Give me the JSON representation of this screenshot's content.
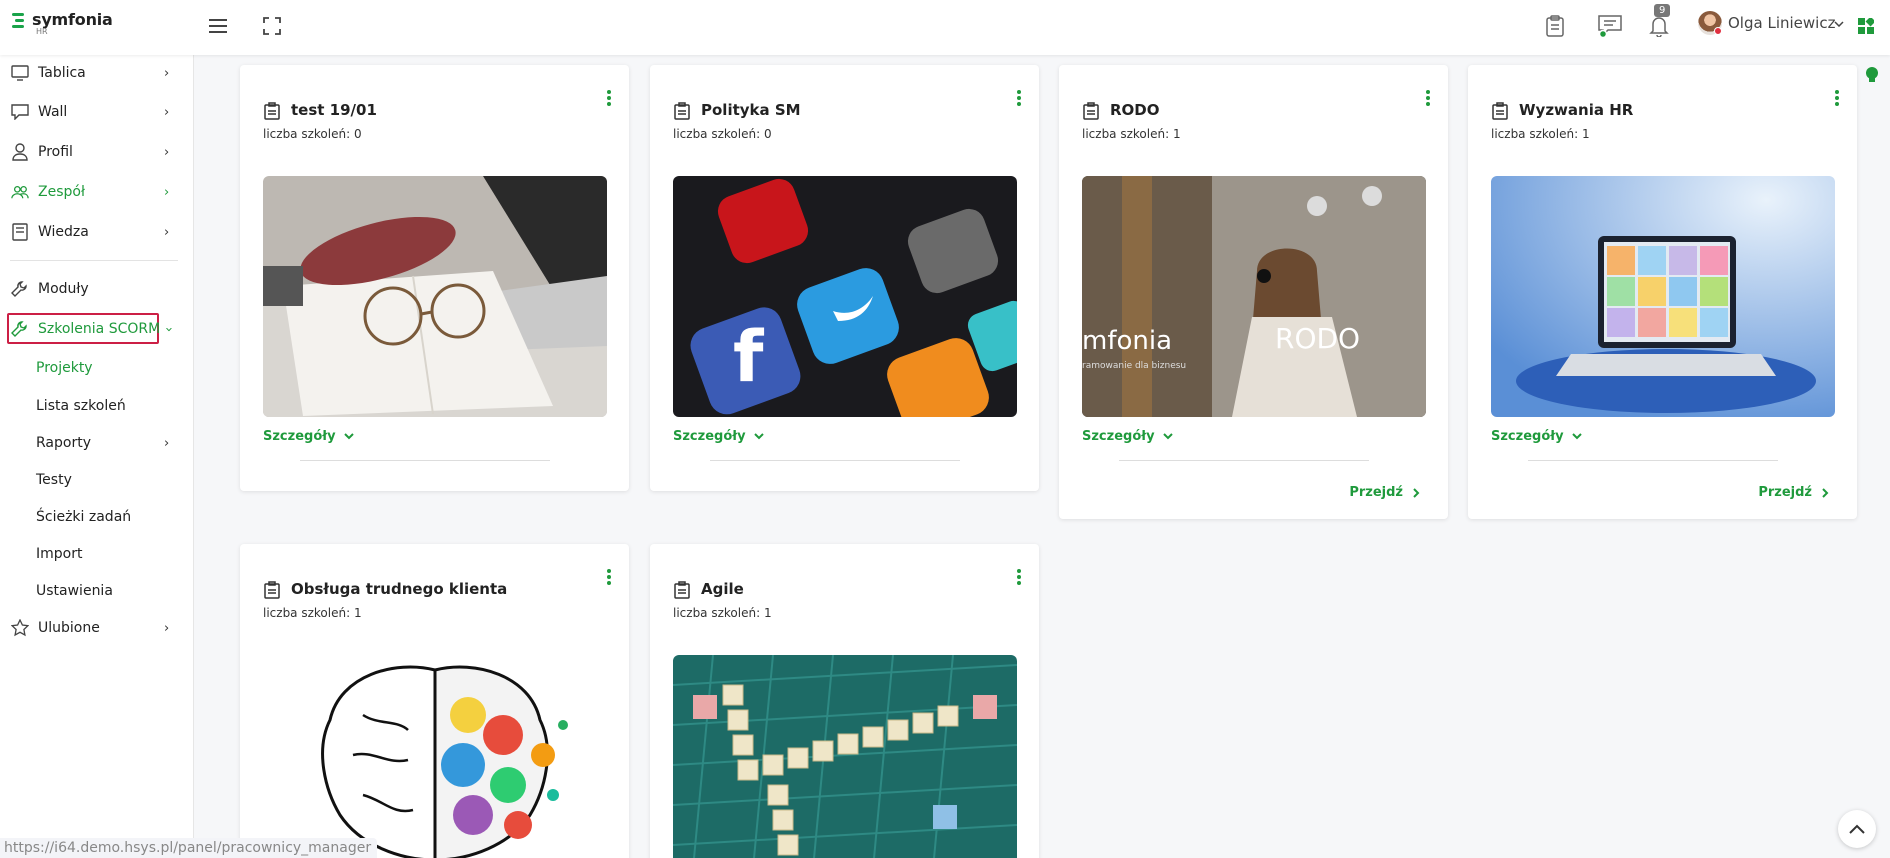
{
  "header": {
    "logo_text": "symfonia",
    "logo_sub": "HR",
    "notification_count": "9",
    "user_name": "Olga Liniewicz"
  },
  "sidebar": {
    "items": [
      {
        "label": "Tablica",
        "icon": "monitor-icon"
      },
      {
        "label": "Wall",
        "icon": "chat-icon"
      },
      {
        "label": "Profil",
        "icon": "user-icon"
      },
      {
        "label": "Zespół",
        "icon": "team-icon"
      },
      {
        "label": "Wiedza",
        "icon": "book-icon"
      },
      {
        "label": "Moduły",
        "icon": "wrench-icon"
      },
      {
        "label": "Szkolenia SCORM",
        "icon": "wrench-icon"
      }
    ],
    "subitems": [
      "Projekty",
      "Lista szkoleń",
      "Raporty",
      "Testy",
      "Ścieżki zadań",
      "Import",
      "Ustawienia"
    ],
    "favorites": {
      "label": "Ulubione",
      "icon": "star-icon"
    }
  },
  "cards": [
    {
      "title": "test 19/01",
      "count": "liczba szkoleń: 0",
      "image": "desk-with-glasses-and-laptop",
      "details": "Szczegóły"
    },
    {
      "title": "Polityka SM",
      "count": "liczba szkoleń: 0",
      "image": "social-media-app-icons",
      "details": "Szczegóły"
    },
    {
      "title": "RODO",
      "count": "liczba szkoleń: 1",
      "image": "woman-with-tablet-rodo",
      "details": "Szczegóły",
      "goto": "Przejdź",
      "img_text_1": "RODO",
      "img_text_2": "mfonia",
      "img_text_3": "ramowanie dla biznesu"
    },
    {
      "title": "Wyzwania HR",
      "count": "liczba szkoleń: 1",
      "image": "laptop-video-call",
      "details": "Szczegóły",
      "goto": "Przejdź"
    },
    {
      "title": "Obsługa trudnego klienta",
      "count": "liczba szkoleń: 1",
      "image": "colorful-brain"
    },
    {
      "title": "Agile",
      "count": "liczba szkoleń: 1",
      "image": "scrabble-lifelong-learning"
    }
  ],
  "status_url": "https://i64.demo.hsys.pl/panel/pracownicy_manager",
  "colors": {
    "accent": "#1f9a3c",
    "active_outline": "#cc1f45"
  }
}
